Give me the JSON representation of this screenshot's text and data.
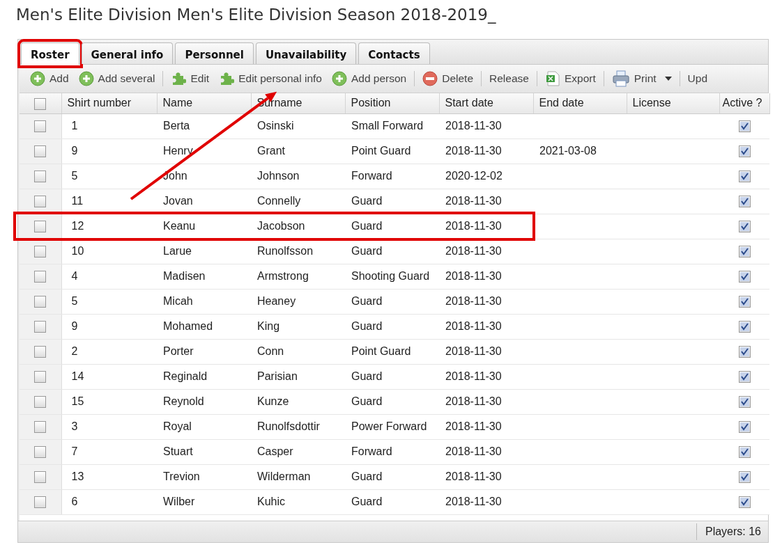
{
  "page_title": "Men's Elite Division Men's Elite Division Season 2018-2019_",
  "tabs": [
    {
      "label": "Roster",
      "selected": true,
      "highlighted": true
    },
    {
      "label": "General info",
      "selected": false,
      "highlighted": false
    },
    {
      "label": "Personnel",
      "selected": false,
      "highlighted": false
    },
    {
      "label": "Unavailability",
      "selected": false,
      "highlighted": false
    },
    {
      "label": "Contacts",
      "selected": false,
      "highlighted": false
    }
  ],
  "toolbar": [
    {
      "kind": "add",
      "label": "Add"
    },
    {
      "kind": "add",
      "label": "Add several"
    },
    {
      "kind": "separator"
    },
    {
      "kind": "edit",
      "label": "Edit"
    },
    {
      "kind": "edit",
      "label": "Edit personal info"
    },
    {
      "kind": "add",
      "label": "Add person"
    },
    {
      "kind": "separator"
    },
    {
      "kind": "delete",
      "label": "Delete"
    },
    {
      "kind": "separator"
    },
    {
      "kind": "plain",
      "label": "Release"
    },
    {
      "kind": "separator"
    },
    {
      "kind": "export",
      "label": "Export"
    },
    {
      "kind": "separator"
    },
    {
      "kind": "print",
      "label": "Print",
      "dropdown": true
    },
    {
      "kind": "separator"
    },
    {
      "kind": "plain",
      "label": "Upd"
    }
  ],
  "table": {
    "select_all": {
      "checked": false
    },
    "columns": [
      "Shirt number",
      "Name",
      "Surname",
      "Position",
      "Start date",
      "End date",
      "License",
      "Active ?"
    ],
    "rows": [
      {
        "cells": [
          "1",
          "Berta",
          "Osinski",
          "Small Forward",
          "2018-11-30",
          "",
          ""
        ],
        "selected": false,
        "active": true,
        "highlighted": false
      },
      {
        "cells": [
          "9",
          "Henry",
          "Grant",
          "Point Guard",
          "2018-11-30",
          "2021-03-08",
          ""
        ],
        "selected": false,
        "active": true,
        "highlighted": false
      },
      {
        "cells": [
          "5",
          "John",
          "Johnson",
          "Forward",
          "2020-12-02",
          "",
          ""
        ],
        "selected": false,
        "active": true,
        "highlighted": false
      },
      {
        "cells": [
          "11",
          "Jovan",
          "Connelly",
          "Guard",
          "2018-11-30",
          "",
          ""
        ],
        "selected": false,
        "active": true,
        "highlighted": false
      },
      {
        "cells": [
          "12",
          "Keanu",
          "Jacobson",
          "Guard",
          "2018-11-30",
          "",
          ""
        ],
        "selected": false,
        "active": true,
        "highlighted": true
      },
      {
        "cells": [
          "10",
          "Larue",
          "Runolfsson",
          "Guard",
          "2018-11-30",
          "",
          ""
        ],
        "selected": false,
        "active": true,
        "highlighted": false
      },
      {
        "cells": [
          "4",
          "Madisen",
          "Armstrong",
          "Shooting Guard",
          "2018-11-30",
          "",
          ""
        ],
        "selected": false,
        "active": true,
        "highlighted": false
      },
      {
        "cells": [
          "5",
          "Micah",
          "Heaney",
          "Guard",
          "2018-11-30",
          "",
          ""
        ],
        "selected": false,
        "active": true,
        "highlighted": false
      },
      {
        "cells": [
          "9",
          "Mohamed",
          "King",
          "Guard",
          "2018-11-30",
          "",
          ""
        ],
        "selected": false,
        "active": true,
        "highlighted": false
      },
      {
        "cells": [
          "2",
          "Porter",
          "Conn",
          "Point Guard",
          "2018-11-30",
          "",
          ""
        ],
        "selected": false,
        "active": true,
        "highlighted": false
      },
      {
        "cells": [
          "14",
          "Reginald",
          "Parisian",
          "Guard",
          "2018-11-30",
          "",
          ""
        ],
        "selected": false,
        "active": true,
        "highlighted": false
      },
      {
        "cells": [
          "15",
          "Reynold",
          "Kunze",
          "Guard",
          "2018-11-30",
          "",
          ""
        ],
        "selected": false,
        "active": true,
        "highlighted": false
      },
      {
        "cells": [
          "3",
          "Royal",
          "Runolfsdottir",
          "Power Forward",
          "2018-11-30",
          "",
          ""
        ],
        "selected": false,
        "active": true,
        "highlighted": false
      },
      {
        "cells": [
          "7",
          "Stuart",
          "Casper",
          "Forward",
          "2018-11-30",
          "",
          ""
        ],
        "selected": false,
        "active": true,
        "highlighted": false
      },
      {
        "cells": [
          "13",
          "Trevion",
          "Wilderman",
          "Guard",
          "2018-11-30",
          "",
          ""
        ],
        "selected": false,
        "active": true,
        "highlighted": false
      },
      {
        "cells": [
          "6",
          "Wilber",
          "Kuhic",
          "Guard",
          "2018-11-30",
          "",
          ""
        ],
        "selected": false,
        "active": true,
        "highlighted": false
      }
    ]
  },
  "status_bar": {
    "text": "Players: 16"
  },
  "annotations": [
    {
      "kind": "arrow"
    }
  ]
}
